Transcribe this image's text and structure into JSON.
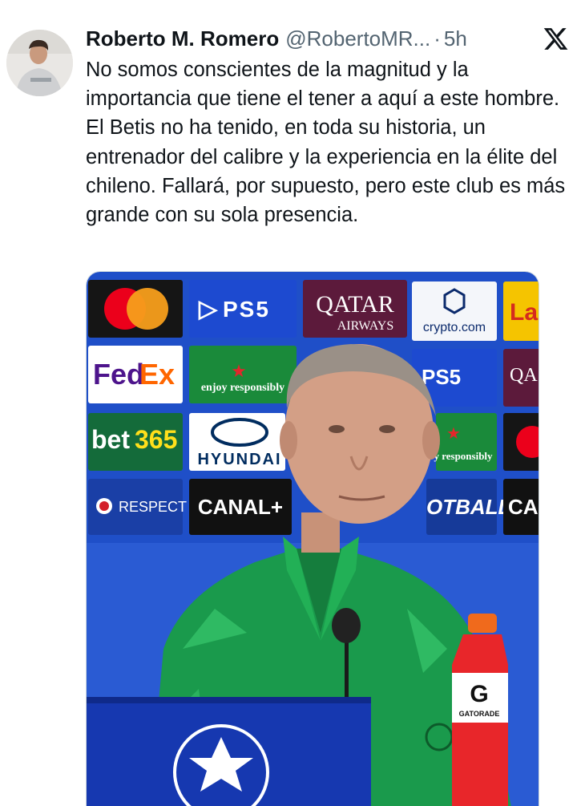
{
  "tweet": {
    "author": {
      "display_name": "Roberto M. Romero",
      "handle": "@RobertoMR...",
      "avatar_icon": "avatar-photo"
    },
    "separator": "·",
    "timestamp": "5h",
    "platform_icon": "x-logo-icon",
    "text": "No somos conscientes de la magnitud y la importancia que tiene el tener a aquí a este hombre. El Betis no ha tenido, en toda su historia, un entrenador del calibre y la experiencia en la élite del chileno. Fallará, por supuesto, pero este club es más grande con su sola presencia."
  },
  "media": {
    "sponsor_logos": {
      "ps5": "PS5",
      "qatar": "QATAR",
      "airways": "AIRWAYS",
      "crypto": "crypto.com",
      "fedex_fed": "Fed",
      "fedex_ex": "Ex",
      "heineken": "enjoy responsibly",
      "heineken_cut": "y responsibly",
      "bet365_bet": "bet",
      "bet365_num": "365",
      "hyundai": "HYUNDAI",
      "respect": "RESPECT",
      "canal": "CANAL+",
      "football": "OTBALL",
      "ca": "CA",
      "qa": "QA",
      "la": "La",
      "gatorade_brand": "GATORADE"
    },
    "colors": {
      "backdrop_blue": "#1f4fc8",
      "jacket_green": "#1a9a4c",
      "bottle_red": "#e8262a"
    }
  }
}
